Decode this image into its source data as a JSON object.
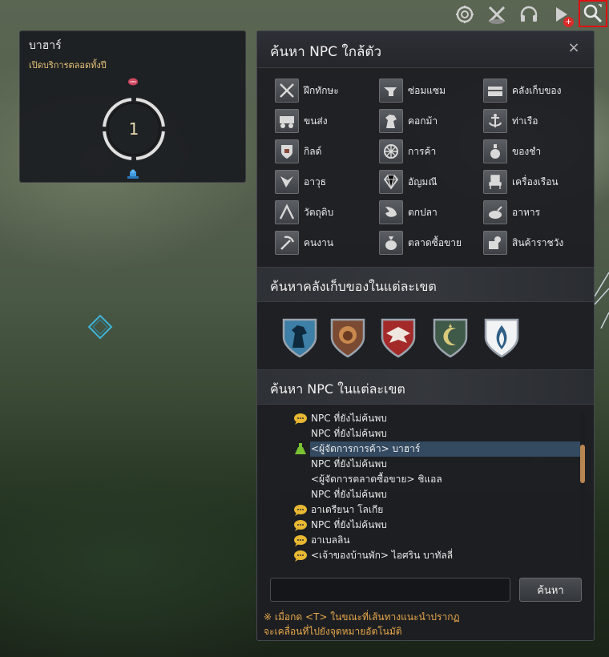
{
  "topbar": {
    "icons": [
      "ring-icon",
      "crossed-swords-icon",
      "headset-icon",
      "play-icon",
      "magnifier-icon"
    ],
    "play_badge": "+"
  },
  "node_panel": {
    "title": "บาฮาร์",
    "subtitle": "เปิดบริการตลอดทั้งปี",
    "number": "1"
  },
  "npc_panel": {
    "title": "ค้นหา NPC ใกล้ตัว",
    "close_label": "×",
    "categories": [
      {
        "label": "ฝึกทักษะ",
        "icon": "skill-icon"
      },
      {
        "label": "ซ่อมแซม",
        "icon": "anvil-icon"
      },
      {
        "label": "คลังเก็บของ",
        "icon": "chest-icon"
      },
      {
        "label": "ขนส่ง",
        "icon": "wagon-icon"
      },
      {
        "label": "คอกม้า",
        "icon": "horse-icon"
      },
      {
        "label": "ท่าเรือ",
        "icon": "anchor-icon"
      },
      {
        "label": "กิลด์",
        "icon": "guild-icon"
      },
      {
        "label": "การค้า",
        "icon": "wheel-icon"
      },
      {
        "label": "ของชำ",
        "icon": "potion-icon"
      },
      {
        "label": "อาวุธ",
        "icon": "weapon-icon"
      },
      {
        "label": "อัญมณี",
        "icon": "gem-icon"
      },
      {
        "label": "เครื่องเรือน",
        "icon": "chair-icon"
      },
      {
        "label": "วัตถุดิบ",
        "icon": "material-icon"
      },
      {
        "label": "ตกปลา",
        "icon": "fish-icon"
      },
      {
        "label": "อาหาร",
        "icon": "food-icon"
      },
      {
        "label": "คนงาน",
        "icon": "pickaxe-icon"
      },
      {
        "label": "ตลาดซื้อขาย",
        "icon": "money-bag-icon"
      },
      {
        "label": "สินค้าราชวัง",
        "icon": "crate-icon"
      }
    ],
    "storage_section_title": "ค้นหาคลังเก็บของในแต่ละเขต",
    "region_shields": [
      {
        "name": "horse-crest",
        "color": "#3d7fa6"
      },
      {
        "name": "lion-crest",
        "color": "#7a4a32"
      },
      {
        "name": "eagle-crest",
        "color": "#a42a2a"
      },
      {
        "name": "moon-crest",
        "color": "#3f5a48"
      },
      {
        "name": "flame-crest",
        "color": "#2f5f86"
      }
    ],
    "npc_section_title": "ค้นหา NPC ในแต่ละเขต",
    "npc_list": [
      {
        "text": "NPC ที่ยังไม่ค้นพบ",
        "icon": "chat-bubble-icon",
        "highlight": false
      },
      {
        "text": "NPC ที่ยังไม่ค้นพบ",
        "icon": "",
        "highlight": false
      },
      {
        "text": "<ผู้จัดการการค้า> บาฮาร์",
        "icon": "flask-icon",
        "highlight": true
      },
      {
        "text": "NPC ที่ยังไม่ค้นพบ",
        "icon": "",
        "highlight": false
      },
      {
        "text": "<ผู้จัดการตลาดซื้อขาย> ชิแอล",
        "icon": "",
        "highlight": false
      },
      {
        "text": "NPC ที่ยังไม่ค้นพบ",
        "icon": "",
        "highlight": false
      },
      {
        "text": "อาเดรียนา โลเกีย",
        "icon": "chat-bubble-icon",
        "highlight": false
      },
      {
        "text": "NPC ที่ยังไม่ค้นพบ",
        "icon": "chat-bubble-icon",
        "highlight": false
      },
      {
        "text": "อาเบลลิน",
        "icon": "chat-bubble-icon",
        "highlight": false
      },
      {
        "text": "<เจ้าของบ้านพัก> ไอศริน บาทัลลี่",
        "icon": "chat-bubble-icon",
        "highlight": false
      }
    ],
    "search": {
      "value": "",
      "placeholder": "",
      "button_label": "ค้นหา"
    },
    "hint_line1": "※ เมื่อกด <T> ในขณะที่เส้นทางแนะนำปรากฏ",
    "hint_line2": "จะเคลื่อนที่ไปยังจุดหมายอัตโนมัติ"
  }
}
